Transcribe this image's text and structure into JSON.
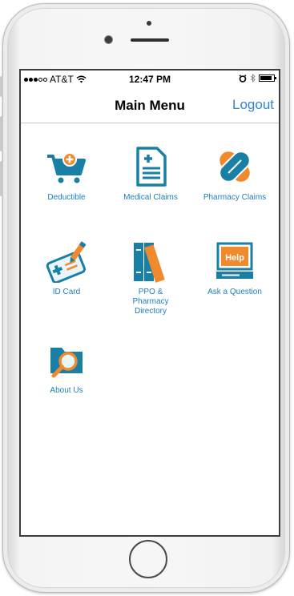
{
  "status_bar": {
    "carrier": "AT&T",
    "time": "12:47 PM",
    "signal_bars_filled": 3,
    "signal_bars_total": 5,
    "battery_level": 0.85
  },
  "nav": {
    "title": "Main Menu",
    "logout_label": "Logout"
  },
  "menu": [
    {
      "label": "Deductible",
      "icon": "cart-icon"
    },
    {
      "label": "Medical Claims",
      "icon": "document-icon"
    },
    {
      "label": "Pharmacy Claims",
      "icon": "pill-icon"
    },
    {
      "label": "ID Card",
      "icon": "id-card-icon"
    },
    {
      "label": "PPO & Pharmacy Directory",
      "icon": "books-icon"
    },
    {
      "label": "Ask a Question",
      "icon": "help-monitor-icon"
    },
    {
      "label": "About Us",
      "icon": "folder-search-icon"
    }
  ],
  "help_icon_text": "Help",
  "colors": {
    "teal": "#1a7fa5",
    "orange": "#f08a2c",
    "link_blue": "#2f86d6",
    "label_blue": "#1d7fb9"
  }
}
